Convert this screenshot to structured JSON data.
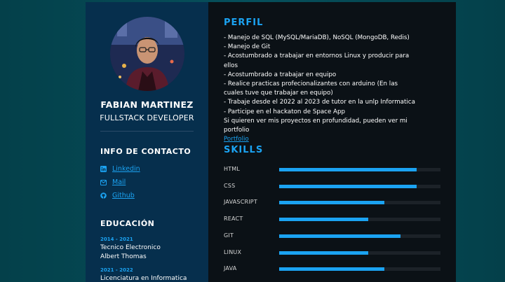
{
  "sidebar": {
    "name": "FABIAN MARTINEZ",
    "role": "FULLSTACK DEVELOPER",
    "contact_heading": "INFO DE CONTACTO",
    "contacts": [
      {
        "label": "Linkedin",
        "icon": "linkedin-icon"
      },
      {
        "label": "Mail",
        "icon": "mail-icon"
      },
      {
        "label": "Github",
        "icon": "github-icon"
      }
    ],
    "education_heading": "EDUCACIÓN",
    "education": [
      {
        "years": "2014 - 2021",
        "title": "Tecnico Electronico",
        "institution": "Albert Thomas"
      },
      {
        "years": "2021 - 2022",
        "title": "Licenciatura en Informatica"
      }
    ]
  },
  "main": {
    "perfil_heading": "PERFIL",
    "perfil_lines": [
      "- Manejo de SQL (MySQL/MariaDB), NoSQL (MongoDB, Redis)",
      "- Manejo de Git",
      "- Acostumbrado a trabajar en entornos Linux y producir para ellos",
      "- Acostumbrado a trabajar en equipo",
      "- Realice practicas profecionalizantes con arduino (En las cuales tuve que trabajar en equipo)",
      "- Trabaje desde el 2022 al 2023 de tutor en la unlp Informatica",
      "- Participe en el hackaton de Space App",
      "Si quieren ver mis proyectos en profundidad, pueden ver mi portfolio"
    ],
    "portfolio_link": "Portfolio",
    "skills_heading": "SKILLS",
    "skills": [
      {
        "name": "HTML",
        "level": 0.85
      },
      {
        "name": "CSS",
        "level": 0.85
      },
      {
        "name": "JAVASCRIPT",
        "level": 0.65
      },
      {
        "name": "REACT",
        "level": 0.55
      },
      {
        "name": "GIT",
        "level": 0.75
      },
      {
        "name": "LINUX",
        "level": 0.55
      },
      {
        "name": "JAVA",
        "level": 0.65
      }
    ]
  },
  "colors": {
    "accent": "#1ba3f2",
    "sidebar_bg": "#062f4d",
    "main_bg": "#0b1116",
    "page_bg": "#06505c"
  }
}
